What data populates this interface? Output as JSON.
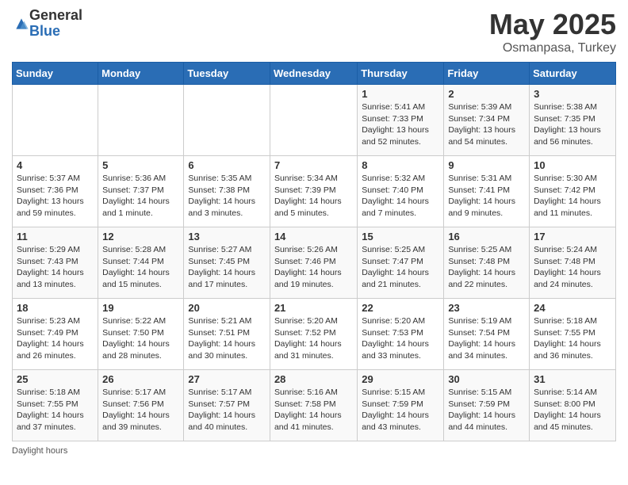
{
  "logo": {
    "general": "General",
    "blue": "Blue"
  },
  "title": "May 2025",
  "subtitle": "Osmanpasa, Turkey",
  "days_of_week": [
    "Sunday",
    "Monday",
    "Tuesday",
    "Wednesday",
    "Thursday",
    "Friday",
    "Saturday"
  ],
  "footer": {
    "daylight_label": "Daylight hours"
  },
  "weeks": [
    [
      {
        "day": "",
        "info": ""
      },
      {
        "day": "",
        "info": ""
      },
      {
        "day": "",
        "info": ""
      },
      {
        "day": "",
        "info": ""
      },
      {
        "day": "1",
        "sunrise": "5:41 AM",
        "sunset": "7:33 PM",
        "daylight": "13 hours and 52 minutes."
      },
      {
        "day": "2",
        "sunrise": "5:39 AM",
        "sunset": "7:34 PM",
        "daylight": "13 hours and 54 minutes."
      },
      {
        "day": "3",
        "sunrise": "5:38 AM",
        "sunset": "7:35 PM",
        "daylight": "13 hours and 56 minutes."
      }
    ],
    [
      {
        "day": "4",
        "sunrise": "5:37 AM",
        "sunset": "7:36 PM",
        "daylight": "13 hours and 59 minutes."
      },
      {
        "day": "5",
        "sunrise": "5:36 AM",
        "sunset": "7:37 PM",
        "daylight": "14 hours and 1 minute."
      },
      {
        "day": "6",
        "sunrise": "5:35 AM",
        "sunset": "7:38 PM",
        "daylight": "14 hours and 3 minutes."
      },
      {
        "day": "7",
        "sunrise": "5:34 AM",
        "sunset": "7:39 PM",
        "daylight": "14 hours and 5 minutes."
      },
      {
        "day": "8",
        "sunrise": "5:32 AM",
        "sunset": "7:40 PM",
        "daylight": "14 hours and 7 minutes."
      },
      {
        "day": "9",
        "sunrise": "5:31 AM",
        "sunset": "7:41 PM",
        "daylight": "14 hours and 9 minutes."
      },
      {
        "day": "10",
        "sunrise": "5:30 AM",
        "sunset": "7:42 PM",
        "daylight": "14 hours and 11 minutes."
      }
    ],
    [
      {
        "day": "11",
        "sunrise": "5:29 AM",
        "sunset": "7:43 PM",
        "daylight": "14 hours and 13 minutes."
      },
      {
        "day": "12",
        "sunrise": "5:28 AM",
        "sunset": "7:44 PM",
        "daylight": "14 hours and 15 minutes."
      },
      {
        "day": "13",
        "sunrise": "5:27 AM",
        "sunset": "7:45 PM",
        "daylight": "14 hours and 17 minutes."
      },
      {
        "day": "14",
        "sunrise": "5:26 AM",
        "sunset": "7:46 PM",
        "daylight": "14 hours and 19 minutes."
      },
      {
        "day": "15",
        "sunrise": "5:25 AM",
        "sunset": "7:47 PM",
        "daylight": "14 hours and 21 minutes."
      },
      {
        "day": "16",
        "sunrise": "5:25 AM",
        "sunset": "7:48 PM",
        "daylight": "14 hours and 22 minutes."
      },
      {
        "day": "17",
        "sunrise": "5:24 AM",
        "sunset": "7:48 PM",
        "daylight": "14 hours and 24 minutes."
      }
    ],
    [
      {
        "day": "18",
        "sunrise": "5:23 AM",
        "sunset": "7:49 PM",
        "daylight": "14 hours and 26 minutes."
      },
      {
        "day": "19",
        "sunrise": "5:22 AM",
        "sunset": "7:50 PM",
        "daylight": "14 hours and 28 minutes."
      },
      {
        "day": "20",
        "sunrise": "5:21 AM",
        "sunset": "7:51 PM",
        "daylight": "14 hours and 30 minutes."
      },
      {
        "day": "21",
        "sunrise": "5:20 AM",
        "sunset": "7:52 PM",
        "daylight": "14 hours and 31 minutes."
      },
      {
        "day": "22",
        "sunrise": "5:20 AM",
        "sunset": "7:53 PM",
        "daylight": "14 hours and 33 minutes."
      },
      {
        "day": "23",
        "sunrise": "5:19 AM",
        "sunset": "7:54 PM",
        "daylight": "14 hours and 34 minutes."
      },
      {
        "day": "24",
        "sunrise": "5:18 AM",
        "sunset": "7:55 PM",
        "daylight": "14 hours and 36 minutes."
      }
    ],
    [
      {
        "day": "25",
        "sunrise": "5:18 AM",
        "sunset": "7:55 PM",
        "daylight": "14 hours and 37 minutes."
      },
      {
        "day": "26",
        "sunrise": "5:17 AM",
        "sunset": "7:56 PM",
        "daylight": "14 hours and 39 minutes."
      },
      {
        "day": "27",
        "sunrise": "5:17 AM",
        "sunset": "7:57 PM",
        "daylight": "14 hours and 40 minutes."
      },
      {
        "day": "28",
        "sunrise": "5:16 AM",
        "sunset": "7:58 PM",
        "daylight": "14 hours and 41 minutes."
      },
      {
        "day": "29",
        "sunrise": "5:15 AM",
        "sunset": "7:59 PM",
        "daylight": "14 hours and 43 minutes."
      },
      {
        "day": "30",
        "sunrise": "5:15 AM",
        "sunset": "7:59 PM",
        "daylight": "14 hours and 44 minutes."
      },
      {
        "day": "31",
        "sunrise": "5:14 AM",
        "sunset": "8:00 PM",
        "daylight": "14 hours and 45 minutes."
      }
    ]
  ]
}
